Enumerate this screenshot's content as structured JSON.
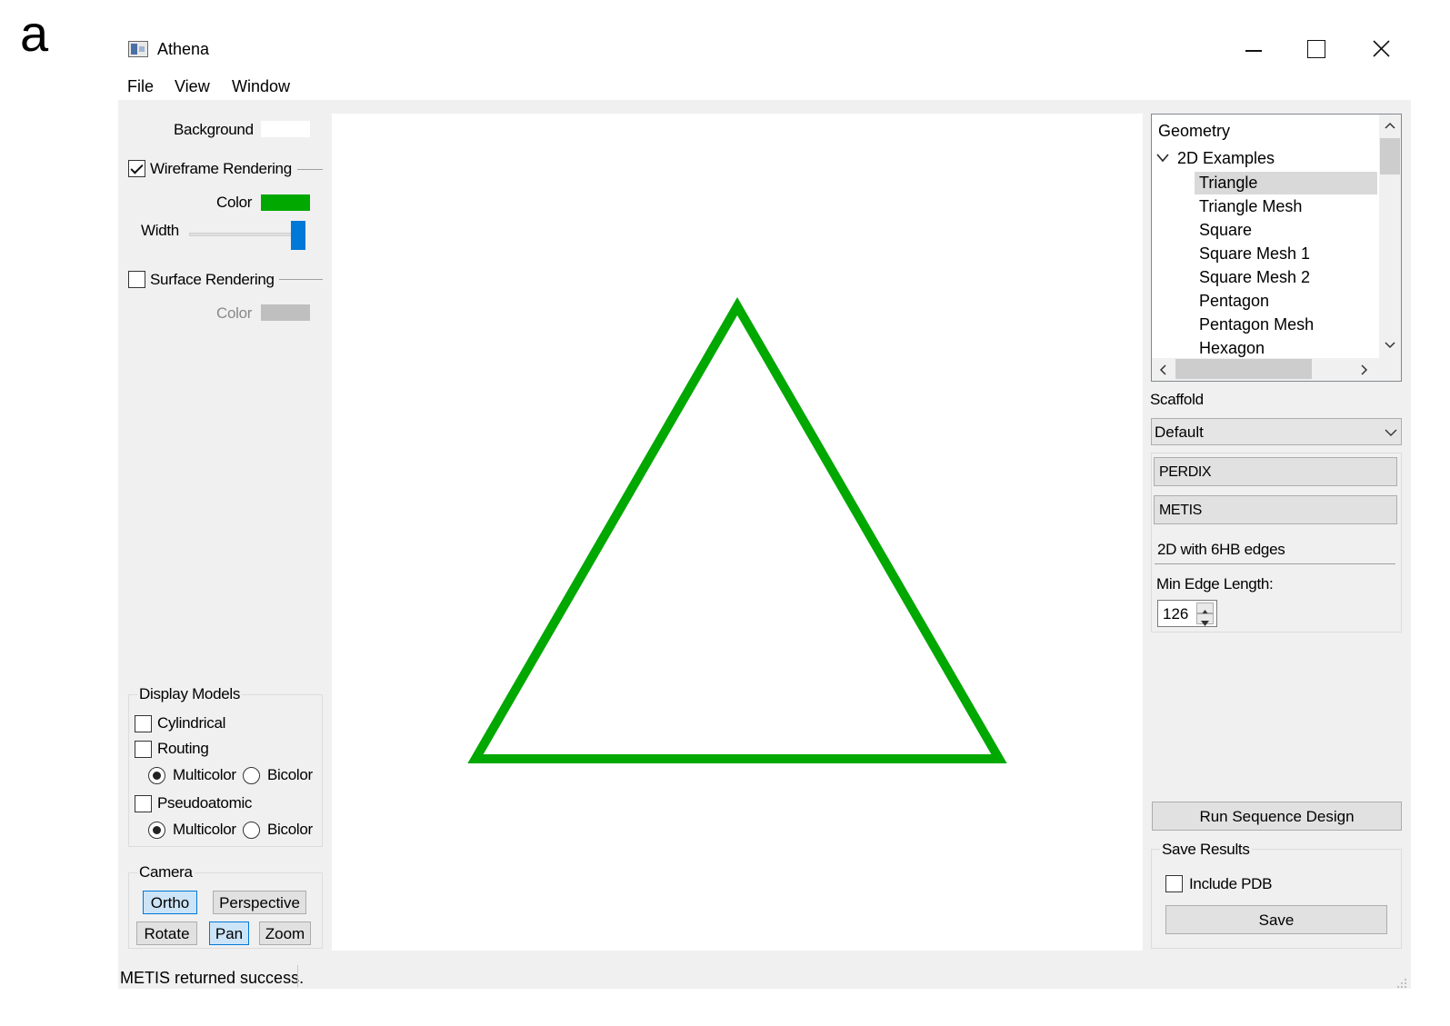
{
  "figure_label": "a",
  "window": {
    "title": "Athena",
    "controls": {
      "minimize": "—",
      "maximize": "☐",
      "close": "✕"
    }
  },
  "menu": [
    "File",
    "View",
    "Window"
  ],
  "left_panel": {
    "background_label": "Background",
    "wireframe": {
      "label": "Wireframe Rendering",
      "checked": true,
      "color_label": "Color",
      "color": "#00a800",
      "width_label": "Width"
    },
    "surface": {
      "label": "Surface Rendering",
      "checked": false,
      "color_label": "Color",
      "color": "#bfbfbf"
    },
    "display_models": {
      "title": "Display Models",
      "cylindrical": "Cylindrical",
      "routing": "Routing",
      "routing_multicolor": "Multicolor",
      "routing_bicolor": "Bicolor",
      "pseudoatomic": "Pseudoatomic",
      "pseudo_multicolor": "Multicolor",
      "pseudo_bicolor": "Bicolor"
    },
    "camera": {
      "title": "Camera",
      "ortho": "Ortho",
      "perspective": "Perspective",
      "rotate": "Rotate",
      "pan": "Pan",
      "zoom": "Zoom"
    }
  },
  "viewport": {
    "shape": "Triangle",
    "stroke_color": "#00a800"
  },
  "right_panel": {
    "tree": {
      "root": "Geometry",
      "group": "2D Examples",
      "items": [
        "Triangle",
        "Triangle Mesh",
        "Square",
        "Square Mesh 1",
        "Square Mesh 2",
        "Pentagon",
        "Pentagon Mesh",
        "Hexagon"
      ],
      "selected": "Triangle"
    },
    "scaffold_label": "Scaffold",
    "scaffold_value": "Default",
    "perdix": "PERDIX",
    "metis": "METIS",
    "mode_label": "2D with 6HB edges",
    "min_edge_label": "Min Edge Length:",
    "min_edge_value": "126",
    "run_button": "Run Sequence Design",
    "save_results": {
      "title": "Save Results",
      "include_pdb": "Include PDB",
      "save": "Save"
    }
  },
  "status": "METIS returned success."
}
